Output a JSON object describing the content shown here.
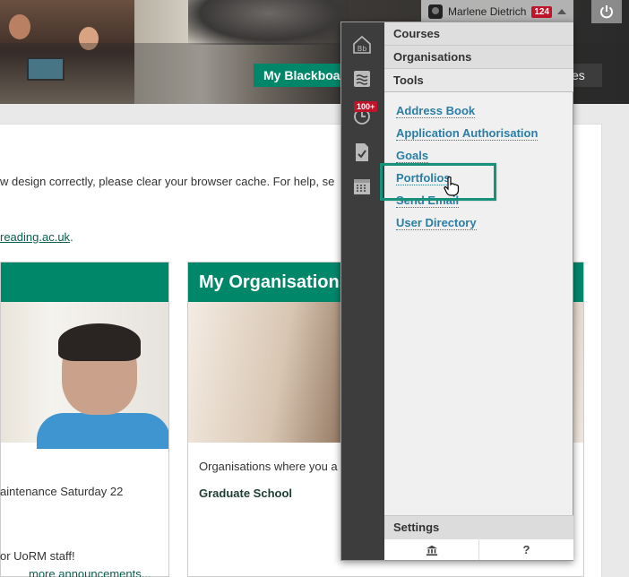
{
  "header": {
    "user_name": "Marlene Dietrich",
    "notification_count": "124",
    "my_tab_label": "My Blackboard",
    "extra_tab_label": "es"
  },
  "page": {
    "notice_text": "w design correctly, please clear your browser cache. For help, se",
    "email_text": "reading.ac.uk",
    "email_suffix": "."
  },
  "modules": {
    "left": {
      "text1": "aintenance Saturday 22",
      "text2": "or UoRM staff!",
      "more_link": "more announcements..."
    },
    "right": {
      "title": "My Organisations",
      "desc": "Organisations where you a",
      "item1": "Graduate School"
    }
  },
  "dropdown": {
    "rail_badge": "100+",
    "sections": {
      "courses": "Courses",
      "organisations": "Organisations",
      "tools": "Tools",
      "settings": "Settings"
    },
    "tools": [
      {
        "label": "Address Book"
      },
      {
        "label": "Application Authorisation"
      },
      {
        "label": "Goals"
      },
      {
        "label": "Portfolios"
      },
      {
        "label": "Send Email"
      },
      {
        "label": "User Directory"
      }
    ],
    "footer": {
      "help_label": "?"
    }
  },
  "colors": {
    "accent_green": "#00876a",
    "link_blue": "#2a7ea6",
    "badge_red": "#c0142a",
    "highlight": "#16917a"
  },
  "icons": [
    "home-icon",
    "stream-icon",
    "history-icon",
    "grades-icon",
    "calendar-icon",
    "institution-icon",
    "power-icon"
  ]
}
